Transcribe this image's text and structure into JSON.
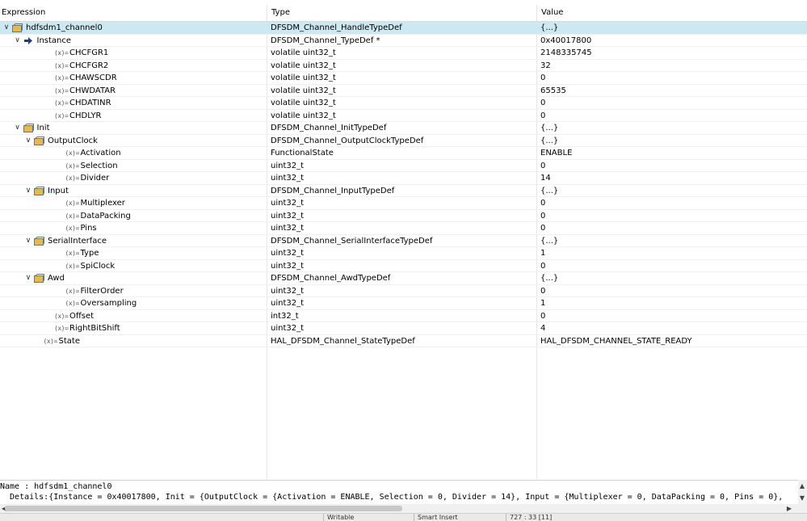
{
  "columns": {
    "expression": "Expression",
    "type": "Type",
    "value": "Value"
  },
  "rows": [
    {
      "name": "hdfsdm1_channel0",
      "type": "DFSDM_Channel_HandleTypeDef",
      "value": "{...}",
      "depth": 0,
      "kind": "struct",
      "expand": "open",
      "selected": true
    },
    {
      "name": "Instance",
      "type": "DFSDM_Channel_TypeDef *",
      "value": "0x40017800",
      "depth": 1,
      "kind": "pointer",
      "expand": "open"
    },
    {
      "name": "CHCFGR1",
      "type": "volatile uint32_t",
      "value": "2148335745",
      "depth": 2,
      "kind": "var"
    },
    {
      "name": "CHCFGR2",
      "type": "volatile uint32_t",
      "value": "32",
      "depth": 2,
      "kind": "var"
    },
    {
      "name": "CHAWSCDR",
      "type": "volatile uint32_t",
      "value": "0",
      "depth": 2,
      "kind": "var"
    },
    {
      "name": "CHWDATAR",
      "type": "volatile uint32_t",
      "value": "65535",
      "depth": 2,
      "kind": "var"
    },
    {
      "name": "CHDATINR",
      "type": "volatile uint32_t",
      "value": "0",
      "depth": 2,
      "kind": "var"
    },
    {
      "name": "CHDLYR",
      "type": "volatile uint32_t",
      "value": "0",
      "depth": 2,
      "kind": "var"
    },
    {
      "name": "Init",
      "type": "DFSDM_Channel_InitTypeDef",
      "value": "{...}",
      "depth": 1,
      "kind": "struct",
      "expand": "open"
    },
    {
      "name": "OutputClock",
      "type": "DFSDM_Channel_OutputClockTypeDef",
      "value": "{...}",
      "depth": 2,
      "kind": "struct",
      "expand": "open"
    },
    {
      "name": "Activation",
      "type": "FunctionalState",
      "value": "ENABLE",
      "depth": 3,
      "kind": "var"
    },
    {
      "name": "Selection",
      "type": "uint32_t",
      "value": "0",
      "depth": 3,
      "kind": "var"
    },
    {
      "name": "Divider",
      "type": "uint32_t",
      "value": "14",
      "depth": 3,
      "kind": "var"
    },
    {
      "name": "Input",
      "type": "DFSDM_Channel_InputTypeDef",
      "value": "{...}",
      "depth": 2,
      "kind": "struct",
      "expand": "open"
    },
    {
      "name": "Multiplexer",
      "type": "uint32_t",
      "value": "0",
      "depth": 3,
      "kind": "var"
    },
    {
      "name": "DataPacking",
      "type": "uint32_t",
      "value": "0",
      "depth": 3,
      "kind": "var"
    },
    {
      "name": "Pins",
      "type": "uint32_t",
      "value": "0",
      "depth": 3,
      "kind": "var"
    },
    {
      "name": "SerialInterface",
      "type": "DFSDM_Channel_SerialInterfaceTypeDef",
      "value": "{...}",
      "depth": 2,
      "kind": "struct",
      "expand": "open"
    },
    {
      "name": "Type",
      "type": "uint32_t",
      "value": "1",
      "depth": 3,
      "kind": "var"
    },
    {
      "name": "SpiClock",
      "type": "uint32_t",
      "value": "0",
      "depth": 3,
      "kind": "var"
    },
    {
      "name": "Awd",
      "type": "DFSDM_Channel_AwdTypeDef",
      "value": "{...}",
      "depth": 2,
      "kind": "struct",
      "expand": "open"
    },
    {
      "name": "FilterOrder",
      "type": "uint32_t",
      "value": "0",
      "depth": 3,
      "kind": "var"
    },
    {
      "name": "Oversampling",
      "type": "uint32_t",
      "value": "1",
      "depth": 3,
      "kind": "var"
    },
    {
      "name": "Offset",
      "type": "int32_t",
      "value": "0",
      "depth": 2,
      "kind": "var"
    },
    {
      "name": "RightBitShift",
      "type": "uint32_t",
      "value": "4",
      "depth": 2,
      "kind": "var"
    },
    {
      "name": "State",
      "type": "HAL_DFSDM_Channel_StateTypeDef",
      "value": "HAL_DFSDM_CHANNEL_STATE_READY",
      "depth": 1,
      "kind": "var"
    }
  ],
  "details": {
    "name_line": "Name : hdfsdm1_channel0",
    "details_line": "  Details:{Instance = 0x40017800, Init = {OutputClock = {Activation = ENABLE, Selection = 0, Divider = 14}, Input = {Multiplexer = 0, DataPacking = 0, Pins = 0},"
  },
  "status": {
    "writable": "Writable",
    "insert_mode": "Smart Insert",
    "position": "727 : 33 [11]"
  },
  "icons": {
    "var": "variable-icon",
    "struct": "struct-icon",
    "pointer": "pointer-arrow-icon",
    "expanded": "chevron-down-icon"
  },
  "colors": {
    "selection": "#cde8f0",
    "folder": "#e8b84a",
    "folder_dark": "#4a7ab0",
    "pointer": "#1f3f7a"
  }
}
